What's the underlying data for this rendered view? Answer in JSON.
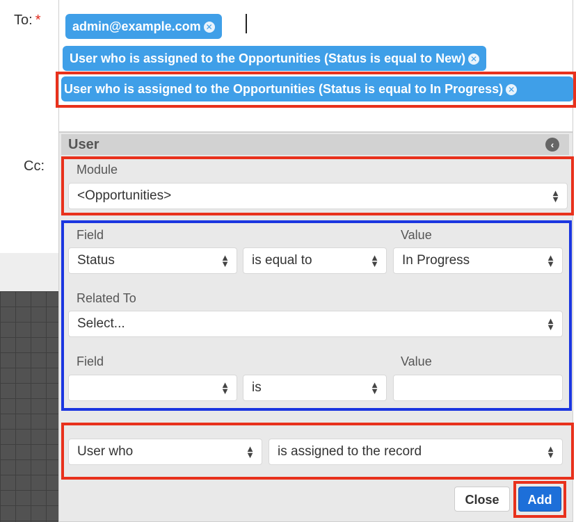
{
  "form": {
    "to_label": "To:",
    "required_mark": "*",
    "cc_label": "Cc:"
  },
  "tokens": [
    {
      "label": "admin@example.com"
    },
    {
      "label": "User who is assigned to the Opportunities (Status is equal to New)"
    },
    {
      "label": "User who is assigned to the Opportunities (Status is equal to In Progress)"
    }
  ],
  "panel": {
    "title": "User",
    "module_label": "Module",
    "module_value": "<Opportunities>",
    "filter1": {
      "field_label": "Field",
      "value_label": "Value",
      "field_value": "Status",
      "operator_value": "is equal to",
      "value_value": "In Progress"
    },
    "related_to_label": "Related To",
    "related_to_value": "Select...",
    "filter2": {
      "field_label": "Field",
      "value_label": "Value",
      "field_value": "",
      "operator_value": "is",
      "value_value": ""
    },
    "user_type_value": "User who",
    "user_relation_value": "is assigned to the record",
    "close_label": "Close",
    "add_label": "Add"
  },
  "colors": {
    "token_bg": "#3f9fe8",
    "highlight_red": "#e8311c",
    "highlight_blue": "#1b36e0",
    "add_button": "#1d6fd9"
  }
}
